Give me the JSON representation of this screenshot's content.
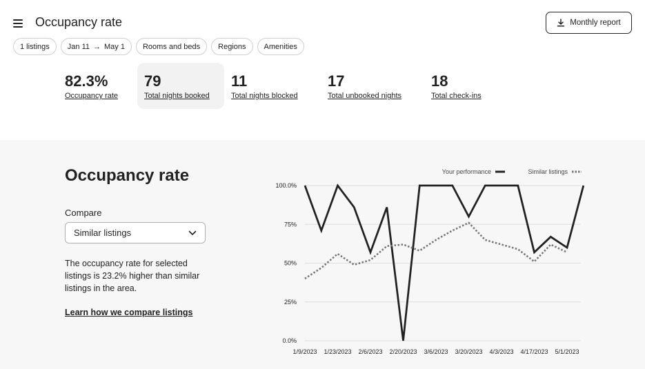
{
  "header": {
    "title": "Occupancy rate",
    "report_button_label": "Monthly report"
  },
  "filters": {
    "listings": "1 listings",
    "date_start": "Jan 11",
    "date_arrow": "→",
    "date_end": "May 1",
    "rooms": "Rooms and beds",
    "regions": "Regions",
    "amenities": "Amenities"
  },
  "stats": [
    {
      "value": "82.3%",
      "label": "Occupancy rate",
      "active": false
    },
    {
      "value": "79",
      "label": "Total nights booked",
      "active": true
    },
    {
      "value": "11",
      "label": "Total nights blocked",
      "active": false
    },
    {
      "value": "17",
      "label": "Total unbooked nights",
      "active": false
    },
    {
      "value": "18",
      "label": "Total check-ins",
      "active": false
    }
  ],
  "section": {
    "title": "Occupancy rate",
    "compare_label": "Compare",
    "compare_selected": "Similar listings",
    "description": "The occupancy rate for selected listings is 23.2% higher than similar listings in the area.",
    "learn_link": "Learn how we compare listings"
  },
  "chart_data": {
    "type": "line",
    "x_tick_labels": [
      "1/9/2023",
      "1/23/2023",
      "2/6/2023",
      "2/20/2023",
      "3/6/2023",
      "3/20/2023",
      "4/3/2023",
      "4/17/2023",
      "5/1/2023"
    ],
    "y_tick_labels": [
      "100.0%",
      "75%",
      "50%",
      "25%",
      "0.0%"
    ],
    "ylim": [
      0,
      100
    ],
    "grid": true,
    "legend_position": "top-right",
    "series": [
      {
        "name": "Your performance",
        "style": "solid",
        "color": "#222222",
        "points": [
          {
            "x": "1/9/2023",
            "y": 100
          },
          {
            "x": "1/16/2023",
            "y": 71
          },
          {
            "x": "1/23/2023",
            "y": 100
          },
          {
            "x": "1/30/2023",
            "y": 86
          },
          {
            "x": "2/6/2023",
            "y": 57
          },
          {
            "x": "2/13/2023",
            "y": 86
          },
          {
            "x": "2/20/2023",
            "y": 0
          },
          {
            "x": "2/27/2023",
            "y": 100
          },
          {
            "x": "3/6/2023",
            "y": 100
          },
          {
            "x": "3/13/2023",
            "y": 100
          },
          {
            "x": "3/20/2023",
            "y": 80
          },
          {
            "x": "3/27/2023",
            "y": 100
          },
          {
            "x": "4/3/2023",
            "y": 100
          },
          {
            "x": "4/10/2023",
            "y": 100
          },
          {
            "x": "4/17/2023",
            "y": 57
          },
          {
            "x": "4/24/2023",
            "y": 67
          },
          {
            "x": "5/1/2023",
            "y": 60
          },
          {
            "x": "5/8/2023",
            "y": 100
          }
        ]
      },
      {
        "name": "Similar listings",
        "style": "dotted",
        "color": "#777777",
        "points": [
          {
            "x": "1/9/2023",
            "y": 40
          },
          {
            "x": "1/16/2023",
            "y": 47
          },
          {
            "x": "1/23/2023",
            "y": 56
          },
          {
            "x": "1/30/2023",
            "y": 49
          },
          {
            "x": "2/6/2023",
            "y": 52
          },
          {
            "x": "2/13/2023",
            "y": 61
          },
          {
            "x": "2/20/2023",
            "y": 62
          },
          {
            "x": "2/27/2023",
            "y": 58
          },
          {
            "x": "3/6/2023",
            "y": 65
          },
          {
            "x": "3/13/2023",
            "y": 71
          },
          {
            "x": "3/20/2023",
            "y": 76
          },
          {
            "x": "3/27/2023",
            "y": 65
          },
          {
            "x": "4/3/2023",
            "y": 62
          },
          {
            "x": "4/10/2023",
            "y": 59
          },
          {
            "x": "4/17/2023",
            "y": 51
          },
          {
            "x": "4/24/2023",
            "y": 62
          },
          {
            "x": "5/1/2023",
            "y": 57
          }
        ]
      }
    ]
  }
}
